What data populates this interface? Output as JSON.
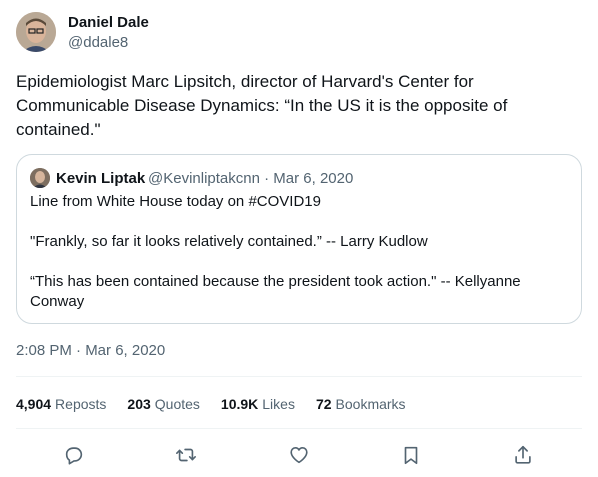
{
  "author": {
    "name": "Daniel Dale",
    "handle": "@ddale8"
  },
  "tweet": {
    "text": "Epidemiologist Marc Lipsitch, director of Harvard's Center for\nCommunicable Disease Dynamics: “In the US it is the opposite of\ncontained.\""
  },
  "quoted": {
    "name": "Kevin Liptak",
    "meta": "@Kevinliptakcnn · Mar 6, 2020",
    "text": "Line from White House today on #COVID19\n\n\"Frankly, so far it looks relatively contained.” -- Larry Kudlow\n\n“This has been contained because the president took action.\" -- Kellyanne\nConway"
  },
  "timestamp": "2:08 PM · Mar 6, 2020",
  "stats": [
    {
      "num": "4,904",
      "label": "Reposts"
    },
    {
      "num": "203",
      "label": "Quotes"
    },
    {
      "num": "10.9K",
      "label": "Likes"
    },
    {
      "num": "72",
      "label": "Bookmarks"
    }
  ],
  "actions": [
    {
      "icon": "reply-icon"
    },
    {
      "icon": "repost-icon"
    },
    {
      "icon": "like-icon"
    },
    {
      "icon": "bookmark-icon"
    },
    {
      "icon": "share-icon"
    }
  ],
  "colors": {
    "text": "#0f1419",
    "muted": "#536471",
    "border": "#cfd9de",
    "divider": "#eff3f4"
  }
}
